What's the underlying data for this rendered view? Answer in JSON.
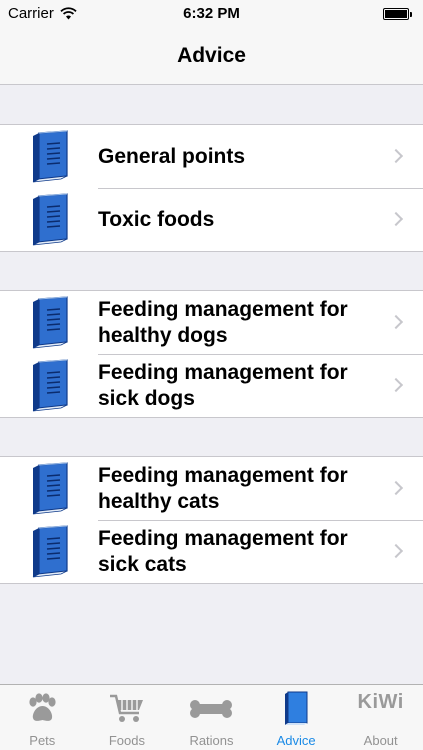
{
  "status_bar": {
    "carrier": "Carrier",
    "time": "6:32 PM",
    "icons": [
      "wifi-icon",
      "battery-icon"
    ]
  },
  "nav": {
    "title": "Advice"
  },
  "sections": [
    {
      "items": [
        {
          "label_line1": "General points",
          "label_line2": "",
          "icon": "book-icon"
        },
        {
          "label_line1": "Toxic foods",
          "label_line2": "",
          "icon": "book-icon"
        }
      ]
    },
    {
      "items": [
        {
          "label_line1": "Feeding management for",
          "label_line2": "healthy dogs",
          "icon": "book-icon"
        },
        {
          "label_line1": "Feeding management for",
          "label_line2": "sick dogs",
          "icon": "book-icon"
        }
      ]
    },
    {
      "items": [
        {
          "label_line1": "Feeding management for",
          "label_line2": "healthy cats",
          "icon": "book-icon"
        },
        {
          "label_line1": "Feeding management for",
          "label_line2": "sick cats",
          "icon": "book-icon"
        }
      ]
    }
  ],
  "tab_bar": {
    "tabs": [
      {
        "label": "Pets",
        "icon": "paw-icon",
        "active": false
      },
      {
        "label": "Foods",
        "icon": "cart-icon",
        "active": false
      },
      {
        "label": "Rations",
        "icon": "bone-icon",
        "active": false
      },
      {
        "label": "Advice",
        "icon": "book-icon",
        "active": true
      },
      {
        "label": "About",
        "icon": "kiwi-logo",
        "logo_text": "KiWi",
        "active": false
      }
    ]
  },
  "colors": {
    "accent": "#1a8ae6",
    "book_blue": "#2f6fcf",
    "book_dark": "#0f3a8a",
    "background": "#efeff4",
    "tab_inactive": "#929292"
  }
}
